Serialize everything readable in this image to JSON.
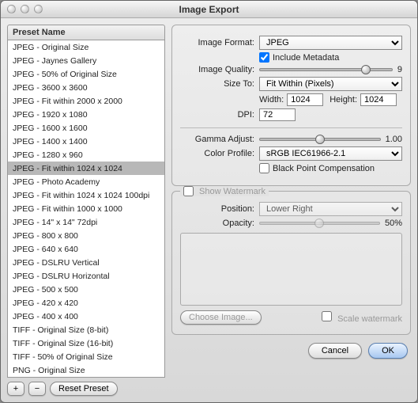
{
  "title": "Image Export",
  "preset_header": "Preset Name",
  "presets": [
    "JPEG - Original Size",
    "JPEG - Jaynes Gallery",
    "JPEG - 50% of Original Size",
    "JPEG - 3600 x 3600",
    "JPEG - Fit within 2000 x 2000",
    "JPEG - 1920 x 1080",
    "JPEG - 1600 x 1600",
    "JPEG - 1400 x 1400",
    "JPEG - 1280 x 960",
    "JPEG - Fit within 1024 x 1024",
    "JPEG - Photo Academy",
    "JPEG - Fit within 1024 x 1024 100dpi",
    "JPEG - Fit within 1000 x 1000",
    "JPEG - 14\" x 14\" 72dpi",
    "JPEG - 800 x 800",
    "JPEG - 640 x 640",
    "JPEG - DSLRU Vertical",
    "JPEG - DSLRU Horizontal",
    "JPEG - 500 x 500",
    "JPEG - 420 x 420",
    "JPEG - 400 x 400",
    "TIFF - Original Size (8-bit)",
    "TIFF - Original Size (16-bit)",
    "TIFF - 50% of Original Size",
    "PNG - Original Size"
  ],
  "selected_preset_index": 9,
  "control_labels": {
    "add": "+",
    "remove": "−",
    "reset": "Reset Preset",
    "cancel": "Cancel",
    "ok": "OK",
    "choose_image": "Choose Image...",
    "scale_watermark": "Scale watermark"
  },
  "labels": {
    "image_format": "Image Format:",
    "include_metadata": "Include Metadata",
    "image_quality": "Image Quality:",
    "size_to": "Size To:",
    "width": "Width:",
    "height": "Height:",
    "dpi": "DPI:",
    "gamma_adjust": "Gamma Adjust:",
    "color_profile": "Color Profile:",
    "black_point": "Black Point Compensation",
    "show_watermark": "Show Watermark",
    "position": "Position:",
    "opacity": "Opacity:"
  },
  "values": {
    "image_format": "JPEG",
    "include_metadata": true,
    "image_quality": 9,
    "size_to": "Fit Within (Pixels)",
    "width": "1024",
    "height": "1024",
    "dpi": "72",
    "gamma_adjust": "1.00",
    "color_profile": "sRGB IEC61966-2.1",
    "black_point": false,
    "show_watermark": false,
    "position": "Lower Right",
    "opacity_label": "50%",
    "scale_watermark": false
  }
}
